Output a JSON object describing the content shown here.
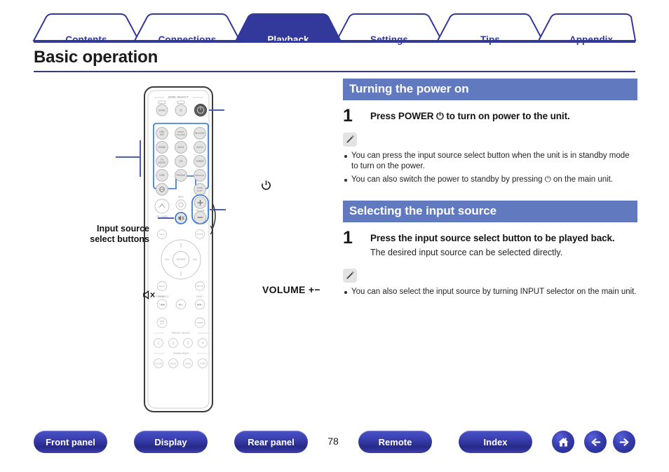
{
  "tabs": [
    {
      "label": "Contents",
      "active": false
    },
    {
      "label": "Connections",
      "active": false
    },
    {
      "label": "Playback",
      "active": true
    },
    {
      "label": "Settings",
      "active": false
    },
    {
      "label": "Tips",
      "active": false
    },
    {
      "label": "Appendix",
      "active": false
    }
  ],
  "page_title": "Basic operation",
  "figure": {
    "callout_input_source_line1": "Input source",
    "callout_input_source_line2": "select buttons",
    "callout_volume": "VOLUME +−",
    "callout_power": "⏻",
    "callout_mute": "⏻",
    "remote": {
      "zone_select_label": "ZONE SELECT",
      "zone_buttons": [
        "MAIN",
        "Z2"
      ],
      "power_button": "⏻",
      "input_source_buttons": [
        "CBL/SAT",
        "MEDIA PLAYER",
        "BLU-RAY",
        "GAME",
        "AUX1",
        "AUX2",
        "TV AUDIO",
        "CD",
        "TUNER",
        "USB",
        "PHONO",
        "Bluetooth",
        "NETWORK",
        "ZONE SELECT"
      ],
      "volume_up": "+",
      "volume_down": "−",
      "volume_label": "VOLUME",
      "mute_button": "MUTE",
      "channel_label": "CH / PAGE",
      "info_label": "INFO",
      "options_label": "OPTION",
      "enter_label": "ENTER",
      "back_label": "BACK",
      "setup_label": "SETUP",
      "tune_down_label": "TUNE −",
      "tune_up_label": "TUNE +",
      "transport_buttons": [
        "⏮",
        "▶‖",
        "⏭"
      ],
      "hdmi_out_label": "HDMI OUT",
      "sleep_label": "SLEEP",
      "preset_select_label": "PRESET SELECT",
      "preset_buttons": [
        "1",
        "2",
        "3",
        "4"
      ],
      "sound_mode_label": "SOUND MODE",
      "sound_mode_buttons": [
        "MOVIE",
        "MUSIC",
        "GAME",
        "PURE"
      ]
    }
  },
  "sections": [
    {
      "header": "Turning the power on",
      "step_number": "1",
      "step_title": "Press POWER ⏻ to turn on power to the unit.",
      "step_sub": "",
      "note_icon": "pencil-icon",
      "bullets": [
        "You can press the input source select button when the unit is in standby mode to turn on the power.",
        "You can also switch the power to standby by pressing ⏻ on the main unit."
      ]
    },
    {
      "header": "Selecting the input source",
      "step_number": "1",
      "step_title": "Press the input source select button to be played back.",
      "step_sub": "The desired input source can be selected directly.",
      "note_icon": "pencil-icon",
      "bullets": [
        "You can also select the input source by turning INPUT selector on the main unit."
      ]
    }
  ],
  "footer": {
    "buttons": [
      {
        "label": "Front panel"
      },
      {
        "label": "Display"
      },
      {
        "label": "Rear panel"
      },
      {
        "label": "Remote"
      },
      {
        "label": "Index"
      }
    ],
    "page_number": "78",
    "icons": [
      {
        "name": "home-icon"
      },
      {
        "name": "arrow-left-icon"
      },
      {
        "name": "arrow-right-icon"
      }
    ]
  },
  "colors": {
    "brand_navy": "#33399b",
    "section_header_blue": "#6079bf",
    "callout_line_blue": "#4a5fb0"
  }
}
